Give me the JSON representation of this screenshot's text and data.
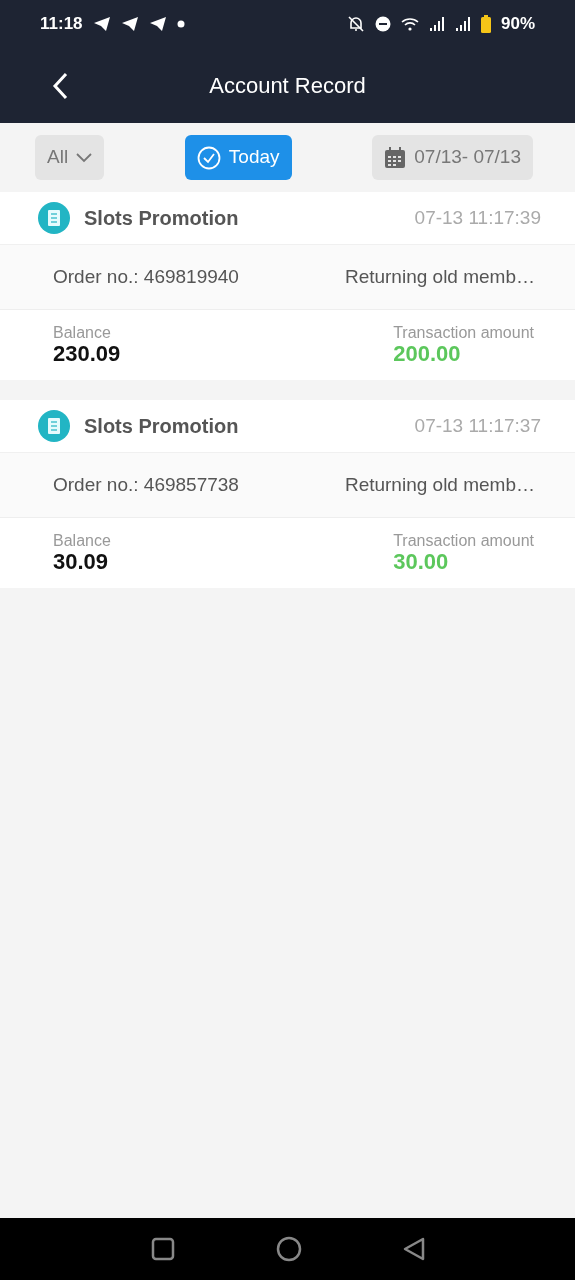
{
  "status_bar": {
    "time": "11:18",
    "battery": "90%"
  },
  "header": {
    "title": "Account Record"
  },
  "filters": [
    {
      "kind": "dropdown",
      "label": "All",
      "selected": false
    },
    {
      "kind": "toggle",
      "label": "Today",
      "selected": true
    },
    {
      "kind": "date",
      "label": "07/13- 07/13",
      "selected": false
    }
  ],
  "records": [
    {
      "title": "Slots Promotion",
      "time": "07-13 11:17:39",
      "order": "Order no.: 469819940",
      "note": "Returning old memb…",
      "balance_label": "Balance",
      "balance": "230.09",
      "amount_label": "Transaction amount",
      "amount": "200.00"
    },
    {
      "title": "Slots Promotion",
      "time": "07-13 11:17:37",
      "order": "Order no.: 469857738",
      "note": "Returning old memb…",
      "balance_label": "Balance",
      "balance": "30.09",
      "amount_label": "Transaction amount",
      "amount": "30.00"
    }
  ]
}
